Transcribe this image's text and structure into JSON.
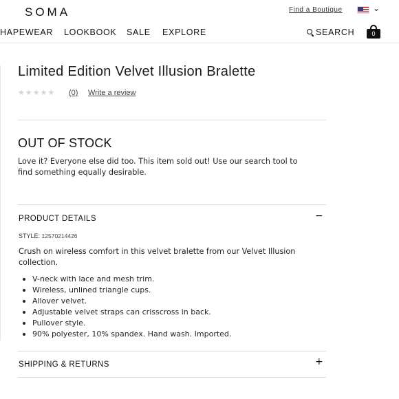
{
  "header": {
    "logo": "SOMA",
    "find_boutique": "Find a Boutique"
  },
  "nav": {
    "items": [
      "HAPEWEAR",
      "LOOKBOOK",
      "SALE",
      "EXPLORE"
    ],
    "search_label": "SEARCH",
    "bag_count": "0"
  },
  "product": {
    "title": "Limited Edition Velvet Illusion Bralette",
    "rating_stars": 5,
    "review_count": "(0)",
    "write_review": "Write a review"
  },
  "stock": {
    "heading": "OUT OF STOCK",
    "message": "Love it? Everyone else did too. This item sold out! Use our search tool to find something equally desirable."
  },
  "details": {
    "heading": "PRODUCT DETAILS",
    "toggle": "−",
    "style_label": "STYLE:",
    "style_number": "12570214426",
    "description": "Crush on wireless comfort in this velvet bralette from our Velvet Illusion collection.",
    "bullets": [
      "V-neck with lace and mesh trim.",
      "Wireless, unlined triangle cups.",
      "Allover velvet.",
      "Adjustable velvet straps can crisscross in back.",
      "Pullover style.",
      "90% polyester, 10% spandex. Hand wash. Imported."
    ]
  },
  "shipping": {
    "heading": "SHIPPING & RETURNS",
    "toggle": "+"
  },
  "colors": {
    "text": "#1a1a1a",
    "rule": "#dcdcdc",
    "star_empty": "#d4d4d4"
  }
}
